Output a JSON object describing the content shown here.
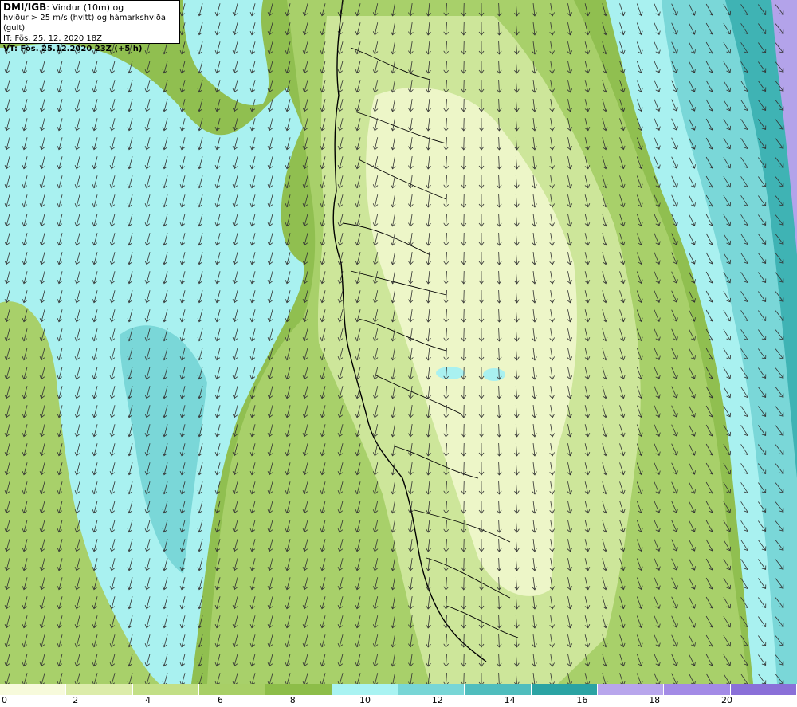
{
  "info": {
    "source": "DMI/IGB",
    "title_rest": ": Vindur (10m) og",
    "line2": "hviður > 25 m/s (hvítt) og hámarkshviða (gult)",
    "line3": "IT: Fös. 25. 12. 2020 18Z",
    "line4": "VT: Fös. 25.12.2020 23Z (+5 h)"
  },
  "legend": {
    "ticks": [
      "0",
      "2",
      "4",
      "6",
      "8",
      "10",
      "12",
      "14",
      "16",
      "18",
      "20"
    ],
    "colors": [
      "#f7fadb",
      "#dcecaa",
      "#c2df86",
      "#a8cf66",
      "#8dbd49",
      "#a9f3f2",
      "#78d6d6",
      "#4fbdbd",
      "#2ba3a3",
      "#b8a6ec",
      "#a38be6",
      "#8a70d8"
    ]
  },
  "palette": {
    "cyan": "#a9f1f0",
    "teal_mid": "#7ad7d8",
    "teal_dark": "#3fb3b4",
    "green_dark": "#90bf50",
    "green_mid": "#a8d06a",
    "green_light": "#cde69a",
    "green_pale": "#edf6c8",
    "purple": "#b3a3ea",
    "coast": "#000000",
    "arrow": "#333333"
  },
  "arrow_field": {
    "direction": "south",
    "rotate_west_deg": 15,
    "rotate_east_deg": -40
  }
}
